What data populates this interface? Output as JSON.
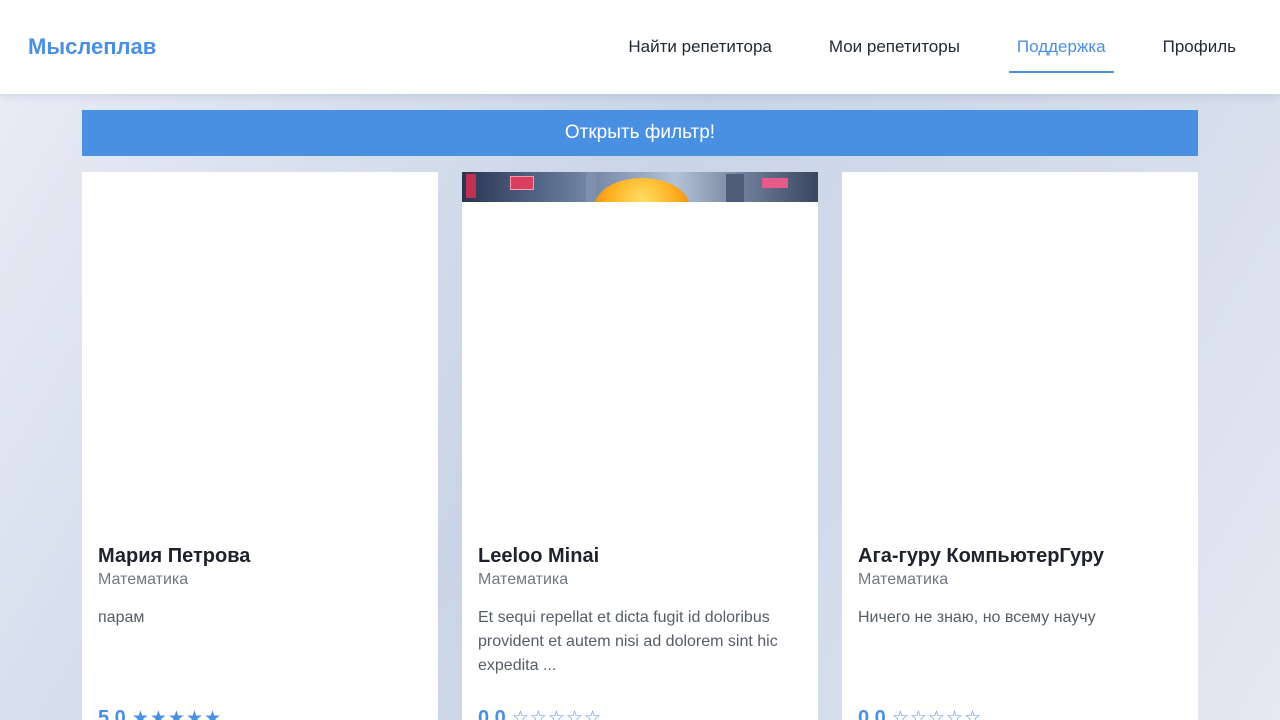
{
  "app": {
    "logo": "Мыслеплав"
  },
  "nav": {
    "items": [
      {
        "label": "Найти репетитора",
        "active": false
      },
      {
        "label": "Мои репетиторы",
        "active": false
      },
      {
        "label": "Поддержка",
        "active": true
      },
      {
        "label": "Профиль",
        "active": false
      }
    ]
  },
  "filter": {
    "label": "Открыть фильтр!"
  },
  "colors": {
    "accent": "#4a90e2",
    "text_dark": "#1e232b",
    "text_muted": "#707880"
  },
  "tutors": [
    {
      "name": "Мария Петрова",
      "subject": "Математика",
      "description": "парам",
      "rating": "5.0",
      "stars_filled": 5,
      "stars_total": 5,
      "has_image": false
    },
    {
      "name": "Leeloo Minai",
      "subject": "Математика",
      "description": "Et sequi repellat et dicta fugit id doloribus provident et autem nisi ad dolorem sint hic expedita ...",
      "rating": "0.0",
      "stars_filled": 0,
      "stars_total": 5,
      "has_image": true
    },
    {
      "name": "Ага-гуру КомпьютерГуру",
      "subject": "Математика",
      "description": "Ничего не знаю, но всему научу",
      "rating": "0.0",
      "stars_filled": 0,
      "stars_total": 5,
      "has_image": false
    }
  ]
}
